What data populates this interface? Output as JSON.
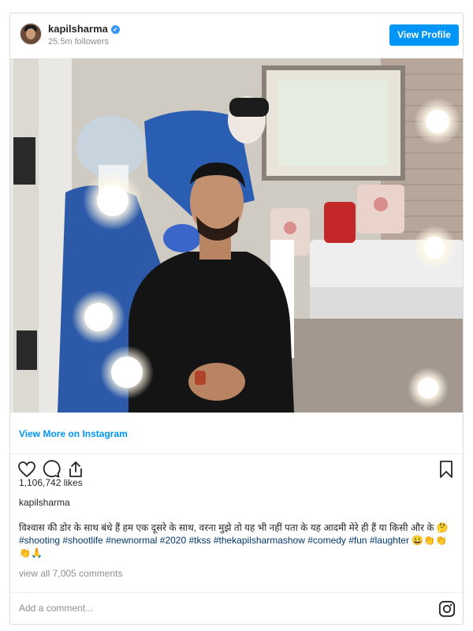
{
  "header": {
    "username": "kapilsharma",
    "verified_icon": "✓",
    "followers": "25.5m followers",
    "view_profile_label": "View Profile"
  },
  "post": {
    "image_alt": "Kapil Sharma in a black t-shirt seated in a make-up room while two people in protective gear and gloves style his hair, with vanity mirror lights",
    "view_more_label": "View More on Instagram",
    "likes": "1,106,742 likes",
    "caption_user": "kapilsharma",
    "caption_text": "विश्वास की डोर के साथ बंधे हैं हम एक दूसरे के साथ, वरना मुझे तो यह भी नहीं पता के यह आदमी मेरे ही हैं या किसी और के 🤔",
    "caption_tags": "#shooting #shootlife #newnormal #2020 #tkss #thekapilsharmashow #comedy #fun #laughter",
    "caption_emojis": "😀👏👏👏🙏",
    "view_all_comments": "view all 7,005 comments",
    "comment_placeholder": "Add a comment..."
  },
  "icons": {
    "like": "heart-icon",
    "comment": "comment-icon",
    "share": "share-icon",
    "save": "bookmark-icon",
    "instagram": "instagram-icon"
  },
  "colors": {
    "accent": "#0095f6",
    "verified": "#3897f0",
    "hashtag": "#00376b"
  }
}
